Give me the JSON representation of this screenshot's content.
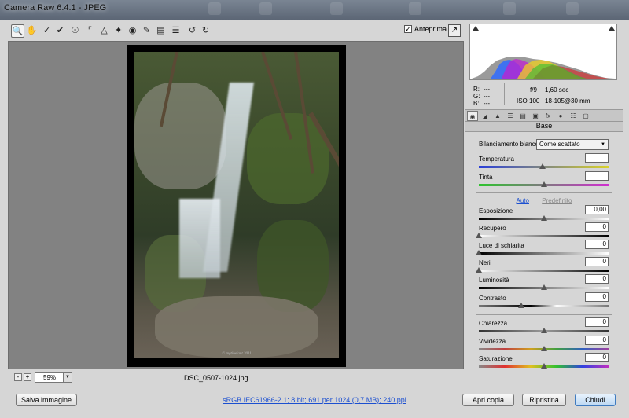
{
  "window": {
    "title": "Camera Raw 6.4.1  -  JPEG"
  },
  "toolbar": {
    "tools": [
      "zoom-icon",
      "hand-icon",
      "white-balance-icon",
      "color-sampler-icon",
      "target-adjust-icon",
      "crop-icon",
      "straighten-icon",
      "spot-removal-icon",
      "red-eye-icon",
      "adjustment-brush-icon",
      "graduated-filter-icon",
      "preferences-icon",
      "rotate-left-icon",
      "rotate-right-icon"
    ],
    "preview_label": "Anteprima",
    "preview_checked": true
  },
  "image": {
    "watermark": "© mgtibelant  2011",
    "filename": "DSC_0507-1024.jpg"
  },
  "zoom": {
    "minus": "-",
    "plus": "+",
    "value": "59%"
  },
  "readout": {
    "r_label": "R:",
    "r_value": "---",
    "g_label": "G:",
    "g_value": "---",
    "b_label": "B:",
    "b_value": "---",
    "aperture": "f/9",
    "shutter": "1,60 sec",
    "iso": "ISO 100",
    "lens": "18-105@30 mm"
  },
  "panel": {
    "title": "Base",
    "wb_label": "Bilanciamento bianco:",
    "wb_value": "Come scattato",
    "auto": "Auto",
    "default": "Predefinito",
    "sliders": {
      "temperatura": {
        "label": "Temperatura",
        "value": ""
      },
      "tinta": {
        "label": "Tinta",
        "value": ""
      },
      "esposizione": {
        "label": "Esposizione",
        "value": "0,00"
      },
      "recupero": {
        "label": "Recupero",
        "value": "0"
      },
      "luce": {
        "label": "Luce di schiarita",
        "value": "0"
      },
      "neri": {
        "label": "Neri",
        "value": "0"
      },
      "luminosita": {
        "label": "Luminosità",
        "value": "0"
      },
      "contrasto": {
        "label": "Contrasto",
        "value": "0"
      },
      "chiarezza": {
        "label": "Chiarezza",
        "value": "0"
      },
      "vividezza": {
        "label": "Vividezza",
        "value": "0"
      },
      "saturazione": {
        "label": "Saturazione",
        "value": "0"
      }
    }
  },
  "footer": {
    "save": "Salva immagine",
    "workflow": "sRGB IEC61966-2.1; 8 bit; 691 per 1024 (0,7 MB); 240 ppi",
    "open": "Apri copia",
    "reset": "Ripristina",
    "close": "Chiudi"
  },
  "colors": {
    "accent_link": "#1b4fd0",
    "primary_button": "#3f7bbf"
  }
}
